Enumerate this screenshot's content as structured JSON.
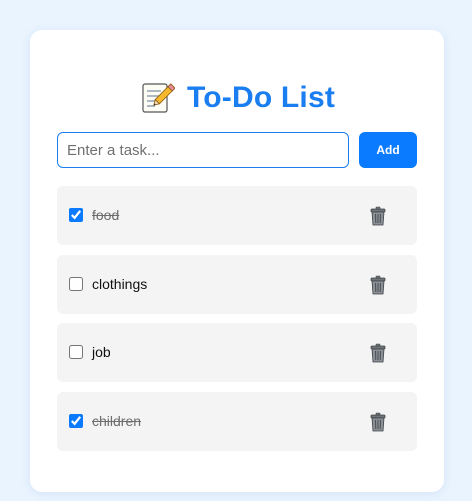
{
  "app": {
    "title": "To-Do List",
    "icon": "memo-pencil-icon"
  },
  "colors": {
    "background": "#eaf4ff",
    "card": "#ffffff",
    "accent": "#1a7ef0",
    "button": "#0a7bff",
    "item_background": "#f4f4f4",
    "done_text": "#6d6d6d"
  },
  "form": {
    "placeholder": "Enter a task...",
    "value": "",
    "add_label": "Add"
  },
  "tasks": [
    {
      "text": "food",
      "done": true,
      "delete_icon": "trash-can-icon"
    },
    {
      "text": "clothings",
      "done": false,
      "delete_icon": "trash-can-icon"
    },
    {
      "text": "job",
      "done": false,
      "delete_icon": "trash-can-icon"
    },
    {
      "text": "children",
      "done": true,
      "delete_icon": "trash-can-icon"
    }
  ]
}
